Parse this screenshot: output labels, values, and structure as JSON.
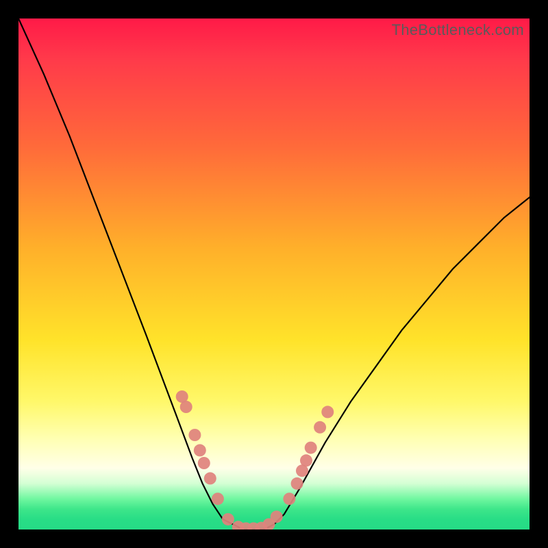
{
  "watermark": "TheBottleneck.com",
  "chart_data": {
    "type": "line",
    "title": "",
    "xlabel": "",
    "ylabel": "",
    "xlim": [
      0,
      100
    ],
    "ylim": [
      0,
      100
    ],
    "series": [
      {
        "name": "bottleneck-curve",
        "x": [
          0,
          5,
          10,
          15,
          20,
          25,
          28,
          31,
          34,
          36,
          38,
          40,
          42,
          44,
          46,
          48,
          50,
          52,
          55,
          60,
          65,
          70,
          75,
          80,
          85,
          90,
          95,
          100
        ],
        "y": [
          100,
          89,
          77,
          64,
          51,
          38,
          30,
          22,
          14,
          9,
          5,
          2,
          1,
          0,
          0,
          0,
          1,
          3,
          8,
          17,
          25,
          32,
          39,
          45,
          51,
          56,
          61,
          65
        ]
      }
    ],
    "markers": {
      "name": "sample-points",
      "color": "#e0827d",
      "points": [
        {
          "x": 32.0,
          "y": 26.0
        },
        {
          "x": 32.8,
          "y": 24.0
        },
        {
          "x": 34.5,
          "y": 18.5
        },
        {
          "x": 35.5,
          "y": 15.5
        },
        {
          "x": 36.3,
          "y": 13.0
        },
        {
          "x": 37.5,
          "y": 10.0
        },
        {
          "x": 39.0,
          "y": 6.0
        },
        {
          "x": 41.0,
          "y": 2.0
        },
        {
          "x": 43.0,
          "y": 0.5
        },
        {
          "x": 44.5,
          "y": 0.2
        },
        {
          "x": 46.0,
          "y": 0.2
        },
        {
          "x": 47.5,
          "y": 0.3
        },
        {
          "x": 49.0,
          "y": 1.0
        },
        {
          "x": 50.5,
          "y": 2.5
        },
        {
          "x": 53.0,
          "y": 6.0
        },
        {
          "x": 54.5,
          "y": 9.0
        },
        {
          "x": 55.5,
          "y": 11.5
        },
        {
          "x": 56.3,
          "y": 13.5
        },
        {
          "x": 57.2,
          "y": 16.0
        },
        {
          "x": 59.0,
          "y": 20.0
        },
        {
          "x": 60.5,
          "y": 23.0
        }
      ]
    }
  }
}
